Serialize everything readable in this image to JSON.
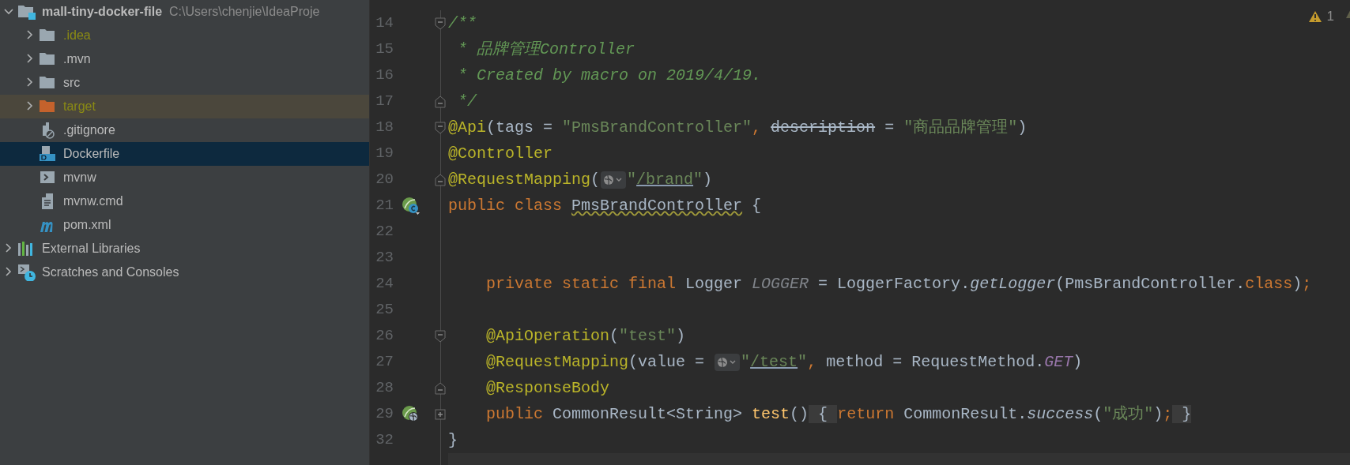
{
  "project_tree": [
    {
      "label": "mall-tiny-docker-file",
      "path": "C:\\Users\\chenjie\\IdeaProje",
      "kind": "module",
      "expanded": true,
      "selected": false,
      "ignored": false,
      "children": [
        {
          "label": ".idea",
          "kind": "folder",
          "expanded": false,
          "selected": false,
          "ignored": true
        },
        {
          "label": ".mvn",
          "kind": "folder",
          "expanded": false,
          "selected": false,
          "ignored": false
        },
        {
          "label": "src",
          "kind": "folder",
          "expanded": false,
          "selected": false,
          "ignored": false
        },
        {
          "label": "target",
          "kind": "excluded-folder",
          "expanded": false,
          "selected": false,
          "ignored": true
        },
        {
          "label": ".gitignore",
          "kind": "ignore-file",
          "selected": false,
          "ignored": false
        },
        {
          "label": "Dockerfile",
          "kind": "docker-file",
          "selected": true,
          "ignored": false
        },
        {
          "label": "mvnw",
          "kind": "script",
          "selected": false,
          "ignored": false
        },
        {
          "label": "mvnw.cmd",
          "kind": "text-file",
          "selected": false,
          "ignored": false
        },
        {
          "label": "pom.xml",
          "kind": "maven",
          "selected": false,
          "ignored": false
        }
      ]
    },
    {
      "label": "External Libraries",
      "kind": "libraries",
      "expanded": false,
      "selected": false,
      "ignored": false
    },
    {
      "label": "Scratches and Consoles",
      "kind": "scratches",
      "expanded": false,
      "selected": false,
      "ignored": false
    }
  ],
  "editor": {
    "warning_count": "1",
    "lines": [
      {
        "number": "14",
        "fold_marker": {
          "kind": "start"
        },
        "tokens": [
          {
            "text": "/**",
            "kind": "doc"
          }
        ]
      },
      {
        "number": "15",
        "tokens": [
          {
            "text": " * 品牌管理Controller",
            "kind": "doc"
          }
        ]
      },
      {
        "number": "16",
        "tokens": [
          {
            "text": " * Created by macro on 2019/4/19.",
            "kind": "doc"
          }
        ]
      },
      {
        "number": "17",
        "fold_marker": {
          "kind": "end"
        },
        "tokens": [
          {
            "text": " */",
            "kind": "doc"
          }
        ]
      },
      {
        "number": "18",
        "fold_marker": {
          "kind": "start"
        },
        "tokens": [
          {
            "text": "@Api",
            "kind": "annotation"
          },
          {
            "text": "(tags = ",
            "kind": "plain"
          },
          {
            "text": "\"PmsBrandController\"",
            "kind": "string"
          },
          {
            "text": ", ",
            "kind": "keyword"
          },
          {
            "text": "description",
            "kind": "deprecated"
          },
          {
            "text": " = ",
            "kind": "plain"
          },
          {
            "text": "\"商品品牌管理\"",
            "kind": "string"
          },
          {
            "text": ")",
            "kind": "plain"
          }
        ]
      },
      {
        "number": "19",
        "tokens": [
          {
            "text": "@Controller",
            "kind": "annotation"
          }
        ]
      },
      {
        "number": "20",
        "fold_marker": {
          "kind": "end"
        },
        "tokens": [
          {
            "text": "@RequestMapping",
            "kind": "annotation"
          },
          {
            "text": "(",
            "kind": "plain"
          },
          {
            "kind": "inlay"
          },
          {
            "text": "\"",
            "kind": "string"
          },
          {
            "text": "/brand",
            "kind": "url"
          },
          {
            "text": "\"",
            "kind": "string"
          },
          {
            "text": ")",
            "kind": "plain"
          }
        ]
      },
      {
        "number": "21",
        "gutter_icon": {
          "kind": "bean"
        },
        "tokens": [
          {
            "text": "public class ",
            "kind": "keyword"
          },
          {
            "text": "PmsBrandController",
            "kind": "warning"
          },
          {
            "text": " {",
            "kind": "plain"
          }
        ]
      },
      {
        "number": "22"
      },
      {
        "number": "23"
      },
      {
        "number": "24",
        "tokens": [
          {
            "text": "    private static final ",
            "kind": "keyword"
          },
          {
            "text": "Logger ",
            "kind": "plain"
          },
          {
            "text": "LOGGER",
            "kind": "constant"
          },
          {
            "text": " = LoggerFactory.",
            "kind": "plain"
          },
          {
            "text": "getLogger",
            "kind": "static-call"
          },
          {
            "text": "(PmsBrandController.",
            "kind": "plain"
          },
          {
            "text": "class",
            "kind": "keyword"
          },
          {
            "text": ")",
            "kind": "plain"
          },
          {
            "text": ";",
            "kind": "keyword"
          }
        ]
      },
      {
        "number": "25"
      },
      {
        "number": "26",
        "fold_marker": {
          "kind": "start"
        },
        "tokens": [
          {
            "text": "    @ApiOperation",
            "kind": "annotation"
          },
          {
            "text": "(",
            "kind": "plain"
          },
          {
            "text": "\"test\"",
            "kind": "string"
          },
          {
            "text": ")",
            "kind": "plain"
          }
        ]
      },
      {
        "number": "27",
        "tokens": [
          {
            "text": "    @RequestMapping",
            "kind": "annotation"
          },
          {
            "text": "(value = ",
            "kind": "plain"
          },
          {
            "kind": "inlay"
          },
          {
            "text": "\"",
            "kind": "string"
          },
          {
            "text": "/test",
            "kind": "url"
          },
          {
            "text": "\"",
            "kind": "string"
          },
          {
            "text": ", ",
            "kind": "keyword"
          },
          {
            "text": "method = RequestMethod.",
            "kind": "plain"
          },
          {
            "text": "GET",
            "kind": "enum"
          },
          {
            "text": ")",
            "kind": "plain"
          }
        ]
      },
      {
        "number": "28",
        "fold_marker": {
          "kind": "end"
        },
        "tokens": [
          {
            "text": "    @ResponseBody",
            "kind": "annotation"
          }
        ]
      },
      {
        "number": "29",
        "fold_marker": {
          "kind": "collapsed"
        },
        "gutter_icon": {
          "kind": "endpoint"
        },
        "tokens": [
          {
            "text": "    public ",
            "kind": "keyword"
          },
          {
            "text": "CommonResult<String> ",
            "kind": "plain"
          },
          {
            "text": "test",
            "kind": "method"
          },
          {
            "text": "()",
            "kind": "plain"
          },
          {
            "text": " { ",
            "kind": "folded"
          },
          {
            "text": "return",
            "kind": "keyword"
          },
          {
            "text": " CommonResult.",
            "kind": "plain"
          },
          {
            "text": "success",
            "kind": "static-call"
          },
          {
            "text": "(",
            "kind": "plain"
          },
          {
            "text": "\"成功\"",
            "kind": "string"
          },
          {
            "text": ")",
            "kind": "plain"
          },
          {
            "text": ";",
            "kind": "keyword"
          },
          {
            "text": " }",
            "kind": "folded"
          }
        ]
      },
      {
        "number": "32",
        "tokens": [
          {
            "text": "}",
            "kind": "plain"
          }
        ]
      }
    ]
  }
}
